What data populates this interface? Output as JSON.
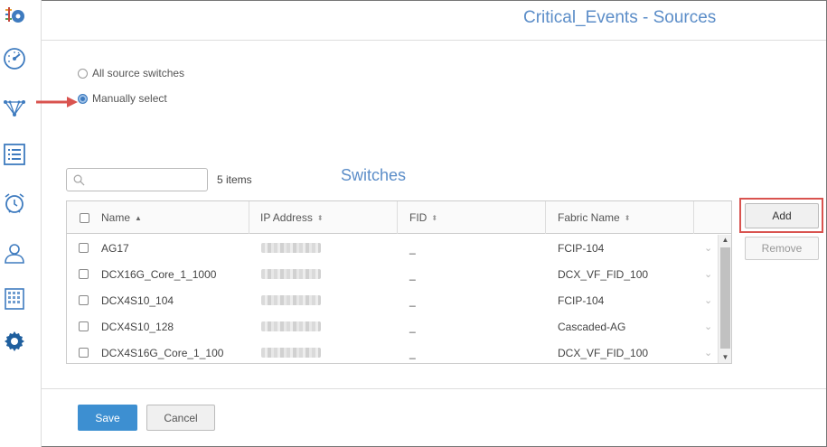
{
  "page": {
    "title": "Critical_Events - Sources"
  },
  "sidebar": {
    "icons": [
      "logo-icon",
      "dashboard-gauge-icon",
      "topology-network-icon",
      "list-icon",
      "alarm-clock-icon",
      "user-icon",
      "grid-building-icon",
      "settings-gear-icon"
    ]
  },
  "source_options": [
    {
      "label": "All source switches",
      "selected": false
    },
    {
      "label": "Manually select",
      "selected": true
    }
  ],
  "search": {
    "placeholder": "",
    "value": ""
  },
  "item_count": "5 items",
  "section_title": "Switches",
  "table": {
    "columns": [
      "Name",
      "IP Address",
      "FID",
      "Fabric Name"
    ],
    "sorted_column": "Name",
    "rows": [
      {
        "name": "AG17",
        "fid": "_",
        "fabric": "FCIP-104"
      },
      {
        "name": "DCX16G_Core_1_1000",
        "fid": "_",
        "fabric": "DCX_VF_FID_100"
      },
      {
        "name": "DCX4S10_104",
        "fid": "_",
        "fabric": "FCIP-104"
      },
      {
        "name": "DCX4S10_128",
        "fid": "_",
        "fabric": "Cascaded-AG"
      },
      {
        "name": "DCX4S16G_Core_1_100",
        "fid": "_",
        "fabric": "DCX_VF_FID_100"
      }
    ]
  },
  "buttons": {
    "add": "Add",
    "remove": "Remove",
    "save": "Save",
    "cancel": "Cancel"
  },
  "colors": {
    "accent": "#3d8fd1",
    "title": "#5b8dc8",
    "highlight": "#d9534f"
  }
}
